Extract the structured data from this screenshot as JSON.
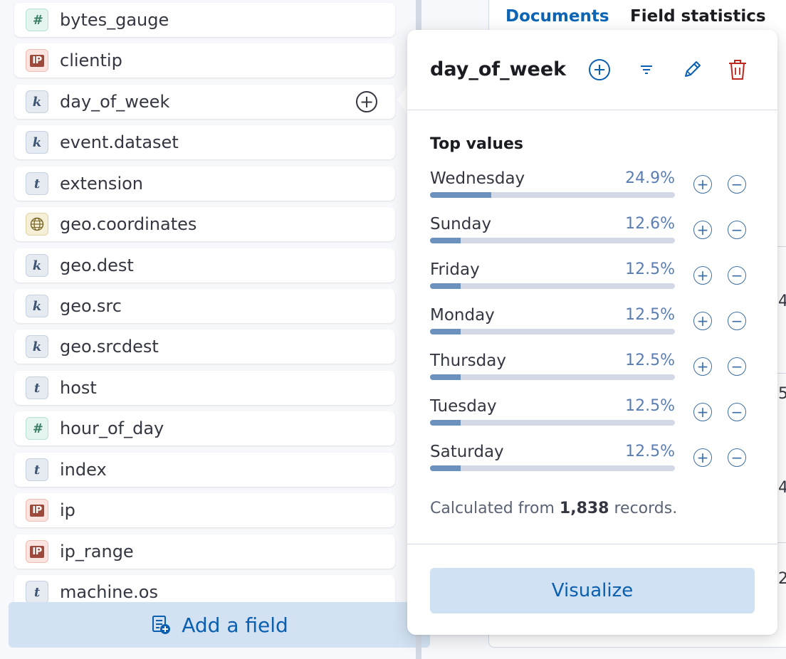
{
  "field_list": {
    "fields": [
      {
        "name": "bytes_gauge",
        "type": "number",
        "type_icon": "number-type-icon",
        "badge": "#"
      },
      {
        "name": "clientip",
        "type": "ip",
        "type_icon": "ip-type-icon",
        "badge": "IP"
      },
      {
        "name": "day_of_week",
        "type": "keyword",
        "type_icon": "keyword-type-icon",
        "badge": "k"
      },
      {
        "name": "event.dataset",
        "type": "keyword",
        "type_icon": "keyword-type-icon",
        "badge": "k"
      },
      {
        "name": "extension",
        "type": "text",
        "type_icon": "text-type-icon",
        "badge": "t"
      },
      {
        "name": "geo.coordinates",
        "type": "geo",
        "type_icon": "globe-icon",
        "badge": ""
      },
      {
        "name": "geo.dest",
        "type": "keyword",
        "type_icon": "keyword-type-icon",
        "badge": "k"
      },
      {
        "name": "geo.src",
        "type": "keyword",
        "type_icon": "keyword-type-icon",
        "badge": "k"
      },
      {
        "name": "geo.srcdest",
        "type": "keyword",
        "type_icon": "keyword-type-icon",
        "badge": "k"
      },
      {
        "name": "host",
        "type": "text",
        "type_icon": "text-type-icon",
        "badge": "t"
      },
      {
        "name": "hour_of_day",
        "type": "number",
        "type_icon": "number-type-icon",
        "badge": "#"
      },
      {
        "name": "index",
        "type": "text",
        "type_icon": "text-type-icon",
        "badge": "t"
      },
      {
        "name": "ip",
        "type": "ip",
        "type_icon": "ip-type-icon",
        "badge": "IP"
      },
      {
        "name": "ip_range",
        "type": "ip",
        "type_icon": "ip-type-icon",
        "badge": "IP"
      },
      {
        "name": "machine.os",
        "type": "text",
        "type_icon": "text-type-icon",
        "badge": "t"
      }
    ],
    "add_field_label": "Add a field"
  },
  "tabs": {
    "documents": "Documents",
    "field_statistics": "Field statistics"
  },
  "background_digits": [
    "4",
    "5",
    "4",
    "2"
  ],
  "popover": {
    "title": "day_of_week",
    "actions": [
      "add-field-icon",
      "filter-icon",
      "pencil-icon",
      "trash-icon"
    ],
    "section_title": "Top values",
    "top_values": [
      {
        "label": "Wednesday",
        "pct": "24.9%",
        "fraction": 0.249
      },
      {
        "label": "Sunday",
        "pct": "12.6%",
        "fraction": 0.126
      },
      {
        "label": "Friday",
        "pct": "12.5%",
        "fraction": 0.125
      },
      {
        "label": "Monday",
        "pct": "12.5%",
        "fraction": 0.125
      },
      {
        "label": "Thursday",
        "pct": "12.5%",
        "fraction": 0.125
      },
      {
        "label": "Tuesday",
        "pct": "12.5%",
        "fraction": 0.125
      },
      {
        "label": "Saturday",
        "pct": "12.5%",
        "fraction": 0.125
      }
    ],
    "footnote_prefix": "Calculated from ",
    "footnote_count": "1,838",
    "footnote_suffix": " records.",
    "visualize_label": "Visualize"
  },
  "colors": {
    "accent": "#0b5fb0",
    "bar_fill": "#6c91bf",
    "bar_track": "#d3dae6",
    "delete": "#bd271e"
  }
}
